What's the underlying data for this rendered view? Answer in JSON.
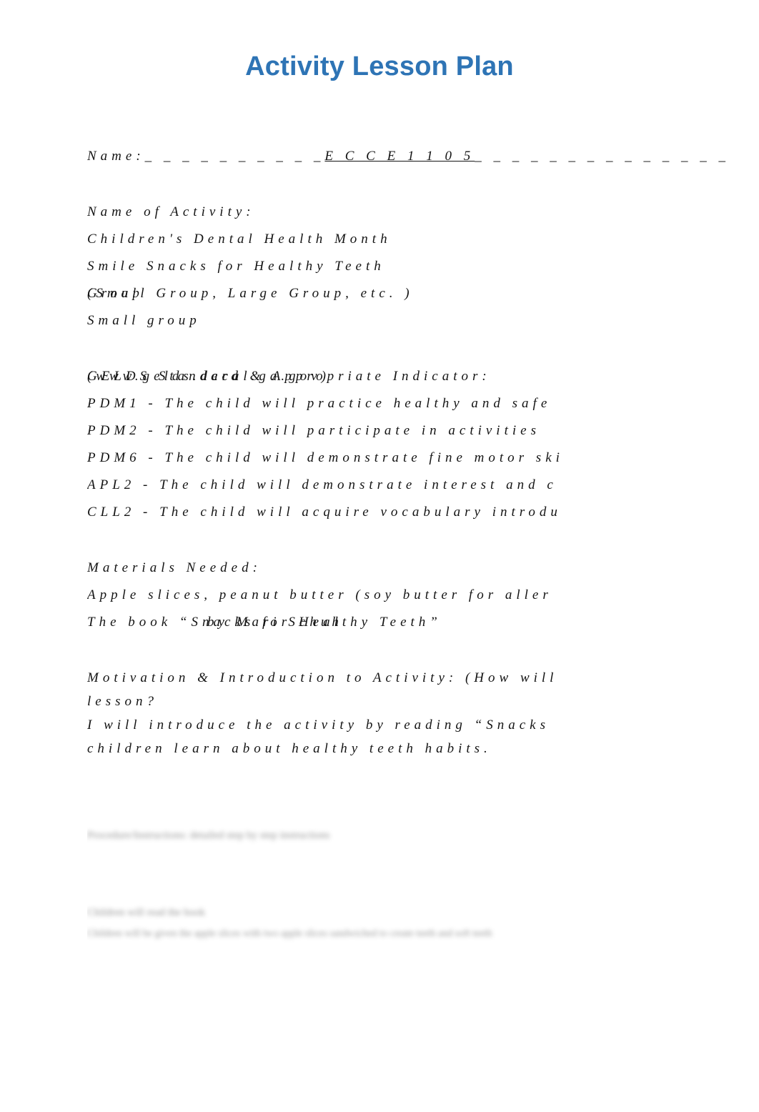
{
  "document": {
    "title": "Activity Lesson Plan",
    "title_color": "#2E74B5",
    "page_background": "#ffffff"
  },
  "name_line": {
    "label": "Name:",
    "leading_rule": "_ _ _ _ _ _ _ _ _ _",
    "value": "E C C E   1 1 0 5",
    "trailing_rule": "_ _ _ _ _ _ _ _ _ _ _ _ _ _"
  },
  "activity": {
    "heading": "Name  of  Activity:",
    "line1": "Children's  Dental  Health  Month",
    "line2": "Smile  Snacks  for  Healthy  Teeth"
  },
  "group": {
    "label": "Group",
    "parenthetical": "(Small  Group,  Large  Group,  etc. )",
    "value": "Small  group"
  },
  "gelds": {
    "heading": "GELDS  Standard  &  Appropriate  Indicator:",
    "heading_overlay": "(www.gelds.decal.ga.gov)",
    "standards": [
      "PDM1 - The  child  will  practice  healthy  and  safe  ",
      "PDM2 - The  child  will  participate  in  activities",
      "PDM6 - The  child  will  demonstrate  fine  motor  ski",
      "APL2 - The  child  will  demonstrate  interest  and  c",
      "CLL2 - The  child  will  acquire  vocabulary  introdu"
    ]
  },
  "materials": {
    "heading": "Materials  Needed:",
    "line1": "Apple  slices,  peanut  butter  (soy  butter  for  aller",
    "book_title": "The  book  “Snacks  for  Healthy  Teeth”",
    "book_author_overlay": "by  Mari  Schuh"
  },
  "motivation": {
    "heading_line1": "Motivation  &  Introduction  to  Activity:  (How  will  ",
    "heading_line2": "lesson?",
    "body_line1": "I  will  introduce  the  activity  by  reading  “Snacks",
    "body_line2": "children  learn  about  healthy  teeth  habits."
  },
  "redacted": {
    "block1_line1": "Procedure/Instructions: detailed step by step instructions",
    "block2_line1": "Children will read the book",
    "block2_line2": "Children will be given the apple slices with two apple slices sandwiched to create teeth and soft teeth"
  }
}
